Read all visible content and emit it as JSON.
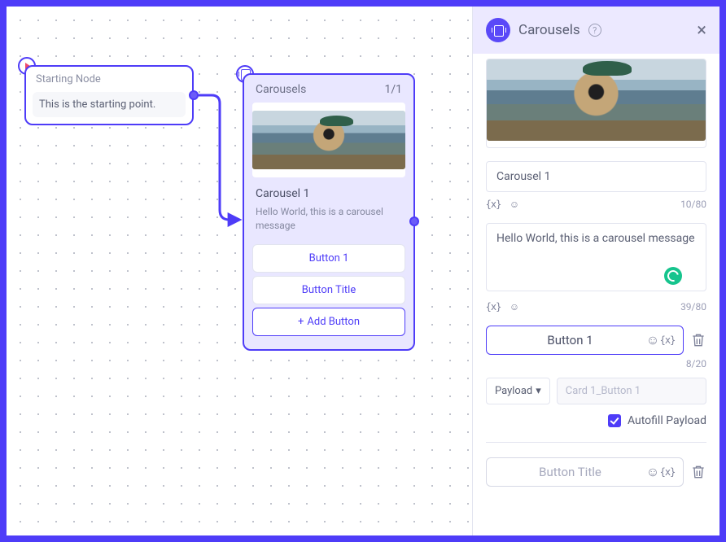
{
  "canvas": {
    "starting_node": {
      "title": "Starting Node",
      "body": "This is the starting point."
    },
    "carousel_node": {
      "header": "Carousels",
      "counter": "1/1",
      "card_title": "Carousel 1",
      "card_desc": "Hello World, this is a carousel message",
      "button1": "Button 1",
      "button2": "Button Title",
      "add_button": "Add Button"
    }
  },
  "sidebar": {
    "title": "Carousels",
    "title_input": "Carousel 1",
    "title_count": "10/80",
    "message_input": "Hello World, this is a carousel message",
    "message_count": "39/80",
    "button1": {
      "label": "Button 1",
      "count": "8/20"
    },
    "payload": {
      "label": "Payload",
      "value": "Card 1_Button 1"
    },
    "autofill_label": "Autofill Payload",
    "button2": {
      "label": "Button Title"
    }
  }
}
